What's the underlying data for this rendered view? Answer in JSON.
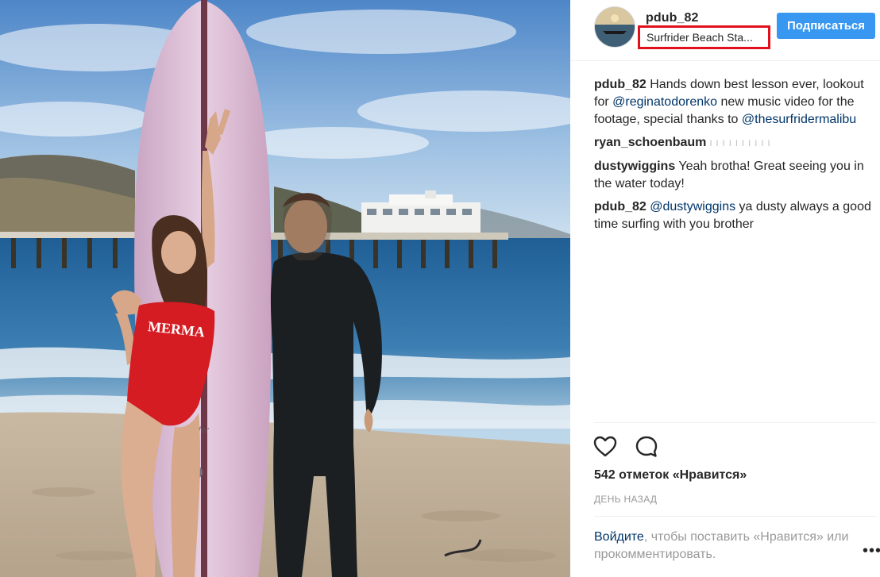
{
  "post": {
    "username": "pdub_82",
    "location": "Surfrider Beach Sta...",
    "follow_label": "Подписаться",
    "swimsuit_text": "MERMA"
  },
  "comments": [
    {
      "author": "pdub_82",
      "parts": [
        {
          "t": "text",
          "v": " Hands down best lesson ever, lookout for "
        },
        {
          "t": "mention",
          "v": "@reginatodorenko"
        },
        {
          "t": "text",
          "v": " new music video for the footage, special thanks to "
        },
        {
          "t": "mention",
          "v": "@thesurfridermalibu"
        }
      ]
    },
    {
      "author": "ryan_schoenbaum",
      "parts": [
        {
          "t": "faint",
          "v": " I I I I I I I I I I"
        }
      ]
    },
    {
      "author": "dustywiggins",
      "parts": [
        {
          "t": "text",
          "v": " Yeah brotha! Great seeing you in the water today!"
        }
      ]
    },
    {
      "author": "pdub_82",
      "parts": [
        {
          "t": "text",
          "v": " "
        },
        {
          "t": "mention",
          "v": "@dustywiggins"
        },
        {
          "t": "text",
          "v": " ya dusty always a good time surfing with you brother"
        }
      ]
    }
  ],
  "actions": {
    "like_icon": "heart-outline-icon",
    "comment_icon": "speech-bubble-icon"
  },
  "likes_text": "542 отметок «Нравится»",
  "timestamp": "ДЕНЬ НАЗАД",
  "login": {
    "link_text": "Войдите",
    "rest_text": ", чтобы поставить «Нравится» или прокомментировать."
  },
  "more_label": "•••",
  "colors": {
    "accent": "#3897f0",
    "mention": "#003569",
    "highlight_box": "#e0101c"
  }
}
